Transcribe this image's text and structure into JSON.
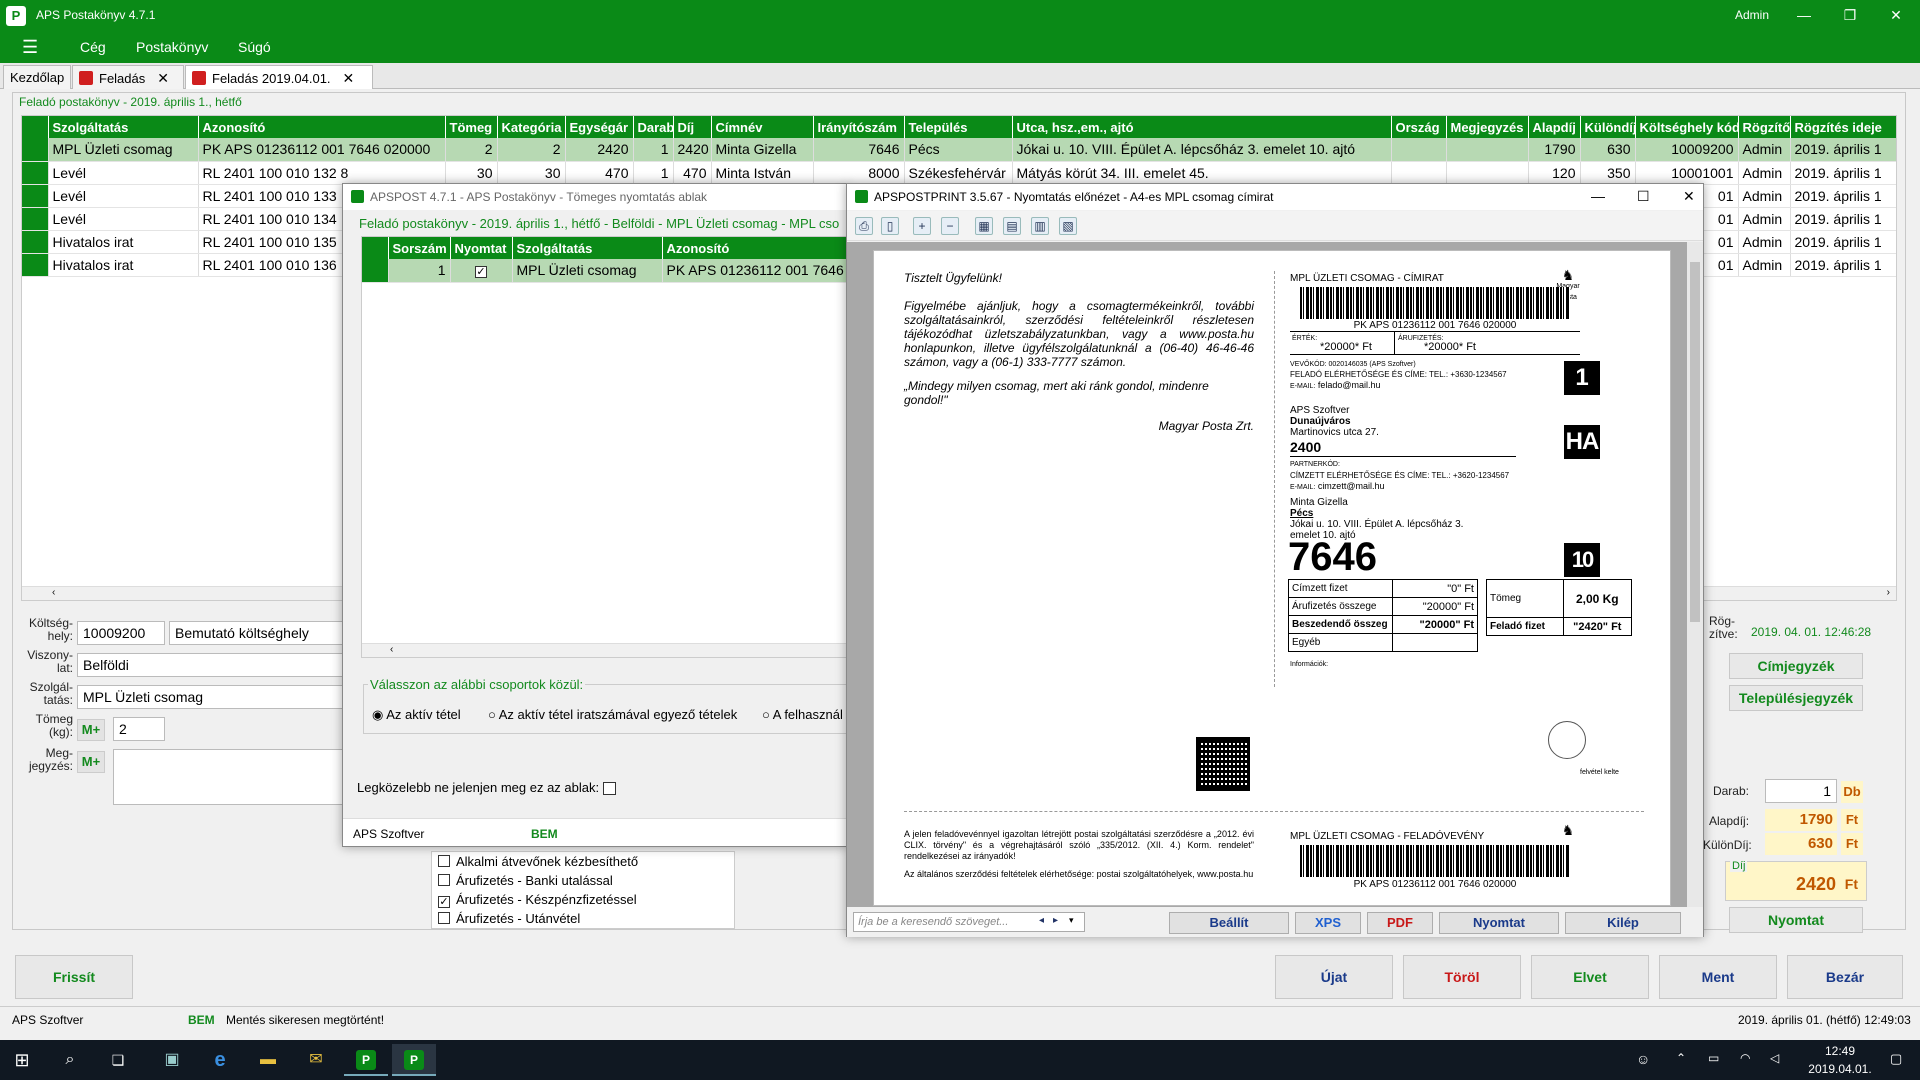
{
  "window": {
    "title": "APS Postakönyv 4.7.1",
    "user": "Admin"
  },
  "menu": {
    "items": [
      "Cég",
      "Postakönyv",
      "Súgó"
    ]
  },
  "tabs": [
    {
      "label": "Kezdőlap"
    },
    {
      "label": "Feladás"
    },
    {
      "label": "Feladás 2019.04.01."
    }
  ],
  "main": {
    "group_title": "Feladó postakönyv - 2019. április 1., hétfő",
    "columns": [
      "Szolgáltatás",
      "Azonosító",
      "Tömeg",
      "Kategória",
      "Egységár",
      "Darab",
      "Díj",
      "Címnév",
      "Irányítószám",
      "Település",
      "Utca, hsz.,em., ajtó",
      "Ország",
      "Megjegyzés",
      "Alapdíj",
      "Különdíj",
      "Költséghely kód",
      "Rögzítő",
      "Rögzítés ideje"
    ],
    "rows": [
      {
        "szolg": "MPL Üzleti csomag",
        "azon": "PK APS 01236112 001 7646 020000",
        "tomeg": "2",
        "kat": "2",
        "egysegar": "2420",
        "darab": "1",
        "dij": "2420",
        "cimnev": "Minta Gizella",
        "irsz": "7646",
        "telep": "Pécs",
        "utca": "Jókai u. 10. VIII. Épület  A. lépcsőház 3. emelet 10. ajtó",
        "orszag": "",
        "megj": "",
        "alapdij": "1790",
        "kulondij": "630",
        "koltseg": "10009200",
        "rogzito": "Admin",
        "ido": "2019. április 1"
      },
      {
        "szolg": "Levél",
        "azon": "RL 2401 100 010 132 8",
        "tomeg": "30",
        "kat": "30",
        "egysegar": "470",
        "darab": "1",
        "dij": "470",
        "cimnev": "Minta István",
        "irsz": "8000",
        "telep": "Székesfehérvár",
        "utca": "Mátyás körút 34. III. emelet 45.",
        "orszag": "",
        "megj": "",
        "alapdij": "120",
        "kulondij": "350",
        "koltseg": "10001001",
        "rogzito": "Admin",
        "ido": "2019. április 1"
      },
      {
        "szolg": "Levél",
        "azon": "RL 2401 100 010 133",
        "rogzito": "Admin",
        "ido": "2019. április 1",
        "kod_tail": "01"
      },
      {
        "szolg": "Levél",
        "azon": "RL 2401 100 010 134",
        "rogzito": "Admin",
        "ido": "2019. április 1",
        "kod_tail": "01"
      },
      {
        "szolg": "Hivatalos irat",
        "azon": "RL 2401 100 010 135",
        "rogzito": "Admin",
        "ido": "2019. április 1",
        "kod_tail": "01"
      },
      {
        "szolg": "Hivatalos irat",
        "azon": "RL 2401 100 010 136",
        "rogzito": "Admin",
        "ido": "2019. április 1",
        "kod_tail": "01"
      }
    ],
    "form": {
      "koltseghely_label": "Költség-hely:",
      "koltseghely_code": "10009200",
      "koltseghely_name": "Bemutató költséghely",
      "viszonylat_label": "Viszony-lat:",
      "viszonylat": "Belföldi",
      "szolgaltatas_label": "Szolgál-tatás:",
      "szolgaltatas": "MPL Üzleti csomag",
      "tomeg_label": "Tömeg (kg):",
      "tomeg": "2",
      "mplus": "M+",
      "megjegyzes_label": "Meg-jegyzés:"
    },
    "options": [
      {
        "label": "Alkalmi átvevőnek kézbesíthető",
        "checked": false
      },
      {
        "label": "Árufizetés - Banki utalással",
        "checked": false
      },
      {
        "label": "Árufizetés - Készpénzfizetéssel",
        "checked": true
      },
      {
        "label": "Árufizetés - Utánvétel",
        "checked": false
      }
    ],
    "right": {
      "rogzitve_label": "Rög-zítve:",
      "rogzitve": "2019. 04. 01. 12:46:28",
      "cimjegyzek": "Címjegyzék",
      "telepulesjegyzek": "Településjegyzék",
      "darab_label": "Darab:",
      "darab": "1",
      "darab_unit": "Db",
      "alapdij_label": "Alapdíj:",
      "alapdij": "1790",
      "kulondij_label": "KülönDíj:",
      "kulondij": "630",
      "ft": "Ft",
      "dij_label": "Díj",
      "dij": "2420",
      "nyomtat": "Nyomtat"
    },
    "buttons": {
      "frissit": "Frissít",
      "ujat": "Újat",
      "torol": "Töröl",
      "elvet": "Elvet",
      "ment": "Ment",
      "bezar": "Bezár"
    }
  },
  "status": {
    "company": "APS Szoftver",
    "bem": "BEM",
    "message": "Mentés sikeresen megtörtént!",
    "datetime": "2019. április 01. (hétfő) 12:49:03"
  },
  "bulk_dialog": {
    "title": "APSPOST 4.7.1 - APS Postakönyv - Tömeges nyomtatás ablak",
    "group_title": "Feladó postakönyv - 2019. április 1., hétfő - Belföldi - MPL Üzleti csomag - MPL cso",
    "columns": [
      "Sorszám",
      "Nyomtat",
      "Szolgáltatás",
      "Azonosító"
    ],
    "row": {
      "sorszam": "1",
      "szolg": "MPL Üzleti csomag",
      "azon": "PK APS 01236112 001 7646"
    },
    "choose_label": "Válasszon az alábbi csoportok közül:",
    "radios": [
      "Az aktív tétel",
      "Az aktív tétel iratszámával egyező tételek",
      "A felhasznál"
    ],
    "dont_show": "Legközelebb ne jelenjen meg ez az ablak:",
    "company": "APS Szoftver",
    "bem": "BEM"
  },
  "preview": {
    "title": "APSPOSTPRINT 3.5.67 - Nyomtatás előnézet - A4-es MPL csomag címirat",
    "letter": {
      "greeting": "Tisztelt Ügyfelünk!",
      "p1": "Figyelmébe ajánljuk, hogy a csomagtermékeinkről, további szolgáltatásainkról, szerződési feltételeinkről részletesen tájékozódhat üzletszabályzatunkban, vagy a www.posta.hu honlapunkon, illetve ügyfélszolgálatunknál a (06-40) 46-46-46 számon, vagy a (06-1) 333-7777 számon.",
      "p2": "„Mindegy milyen csomag, mert aki ránk gondol, mindenre gondol!\"",
      "sign": "Magyar Posta Zrt."
    },
    "label": {
      "header": "MPL ÜZLETI CSOMAG - CÍMIRAT",
      "logo": "Magyar Posta",
      "barcode": "PK APS 01236112 001 7646 020000",
      "ertek_label": "ÉRTÉK:",
      "ertek": "*20000* Ft",
      "arufizetes_label": "ÁRUFIZETÉS:",
      "arufizetes": "*20000* Ft",
      "vevokod": "VEVŐKÓD: 0020146035 (APS Szoftver)",
      "felado_contact": "FELADÓ ELÉRHETŐSÉGE ÉS CÍME: TEL.: +3630-1234567",
      "felado_email_label": "E-MAIL:",
      "felado_email": "felado@mail.hu",
      "box1": "1",
      "sender_name": "APS Szoftver",
      "sender_city": "Dunaújváros",
      "sender_street": "Martinovics utca 27.",
      "sender_zip": "2400",
      "ha": "HA",
      "partnerkod": "PARTNERKÓD:",
      "cimzett_contact": "CÍMZETT ELÉRHETŐSÉGE ÉS CÍME: TEL.: +3620-1234567",
      "cimzett_email_label": "E-MAIL:",
      "cimzett_email": "cimzett@mail.hu",
      "rec_name": "Minta Gizella",
      "rec_city": "Pécs",
      "rec_street": "Jókai u. 10. VIII. Épület  A. lépcsőház 3.",
      "rec_street2": "emelet 10. ajtó",
      "rec_zip": "7646",
      "box10": "10",
      "t_cimzett_label": "Címzett fizet",
      "t_cimzett": "\"0\" Ft",
      "t_arufiz_label": "Árufizetés összege",
      "t_arufiz": "\"20000\" Ft",
      "t_besz_label": "Beszedendő összeg",
      "t_besz": "\"20000\" Ft",
      "t_egyeb_label": "Egyéb",
      "tomeg_label": "Tömeg",
      "tomeg": "2,00 Kg",
      "felado_fizet_label": "Feladó fizet",
      "felado_fizet": "\"2420\" Ft",
      "info": "Információk:",
      "felvetel": "felvétel kelte"
    },
    "lower": {
      "text1": "A jelen feladóvevénnyel igazoltan létrejött postai szolgáltatási szerződésre a „2012. évi CLIX. törvény\" és a végrehajtásáról szóló „335/2012. (XII. 4.) Korm. rendelet\" rendelkezései az irányadók!",
      "text2": "Az általános szerződési feltételek elérhetősége: postai szolgáltatóhelyek, www.posta.hu",
      "header": "MPL ÜZLETI CSOMAG - FELADÓVEVÉNY",
      "barcode": "PK APS 01236112 001 7646 020000"
    },
    "search_placeholder": "Írja be a keresendő szöveget...",
    "buttons": {
      "beallit": "Beállít",
      "xps": "XPS",
      "pdf": "PDF",
      "nyomtat": "Nyomtat",
      "kilep": "Kilép"
    }
  },
  "taskbar": {
    "time": "12:49",
    "date": "2019.04.01."
  }
}
